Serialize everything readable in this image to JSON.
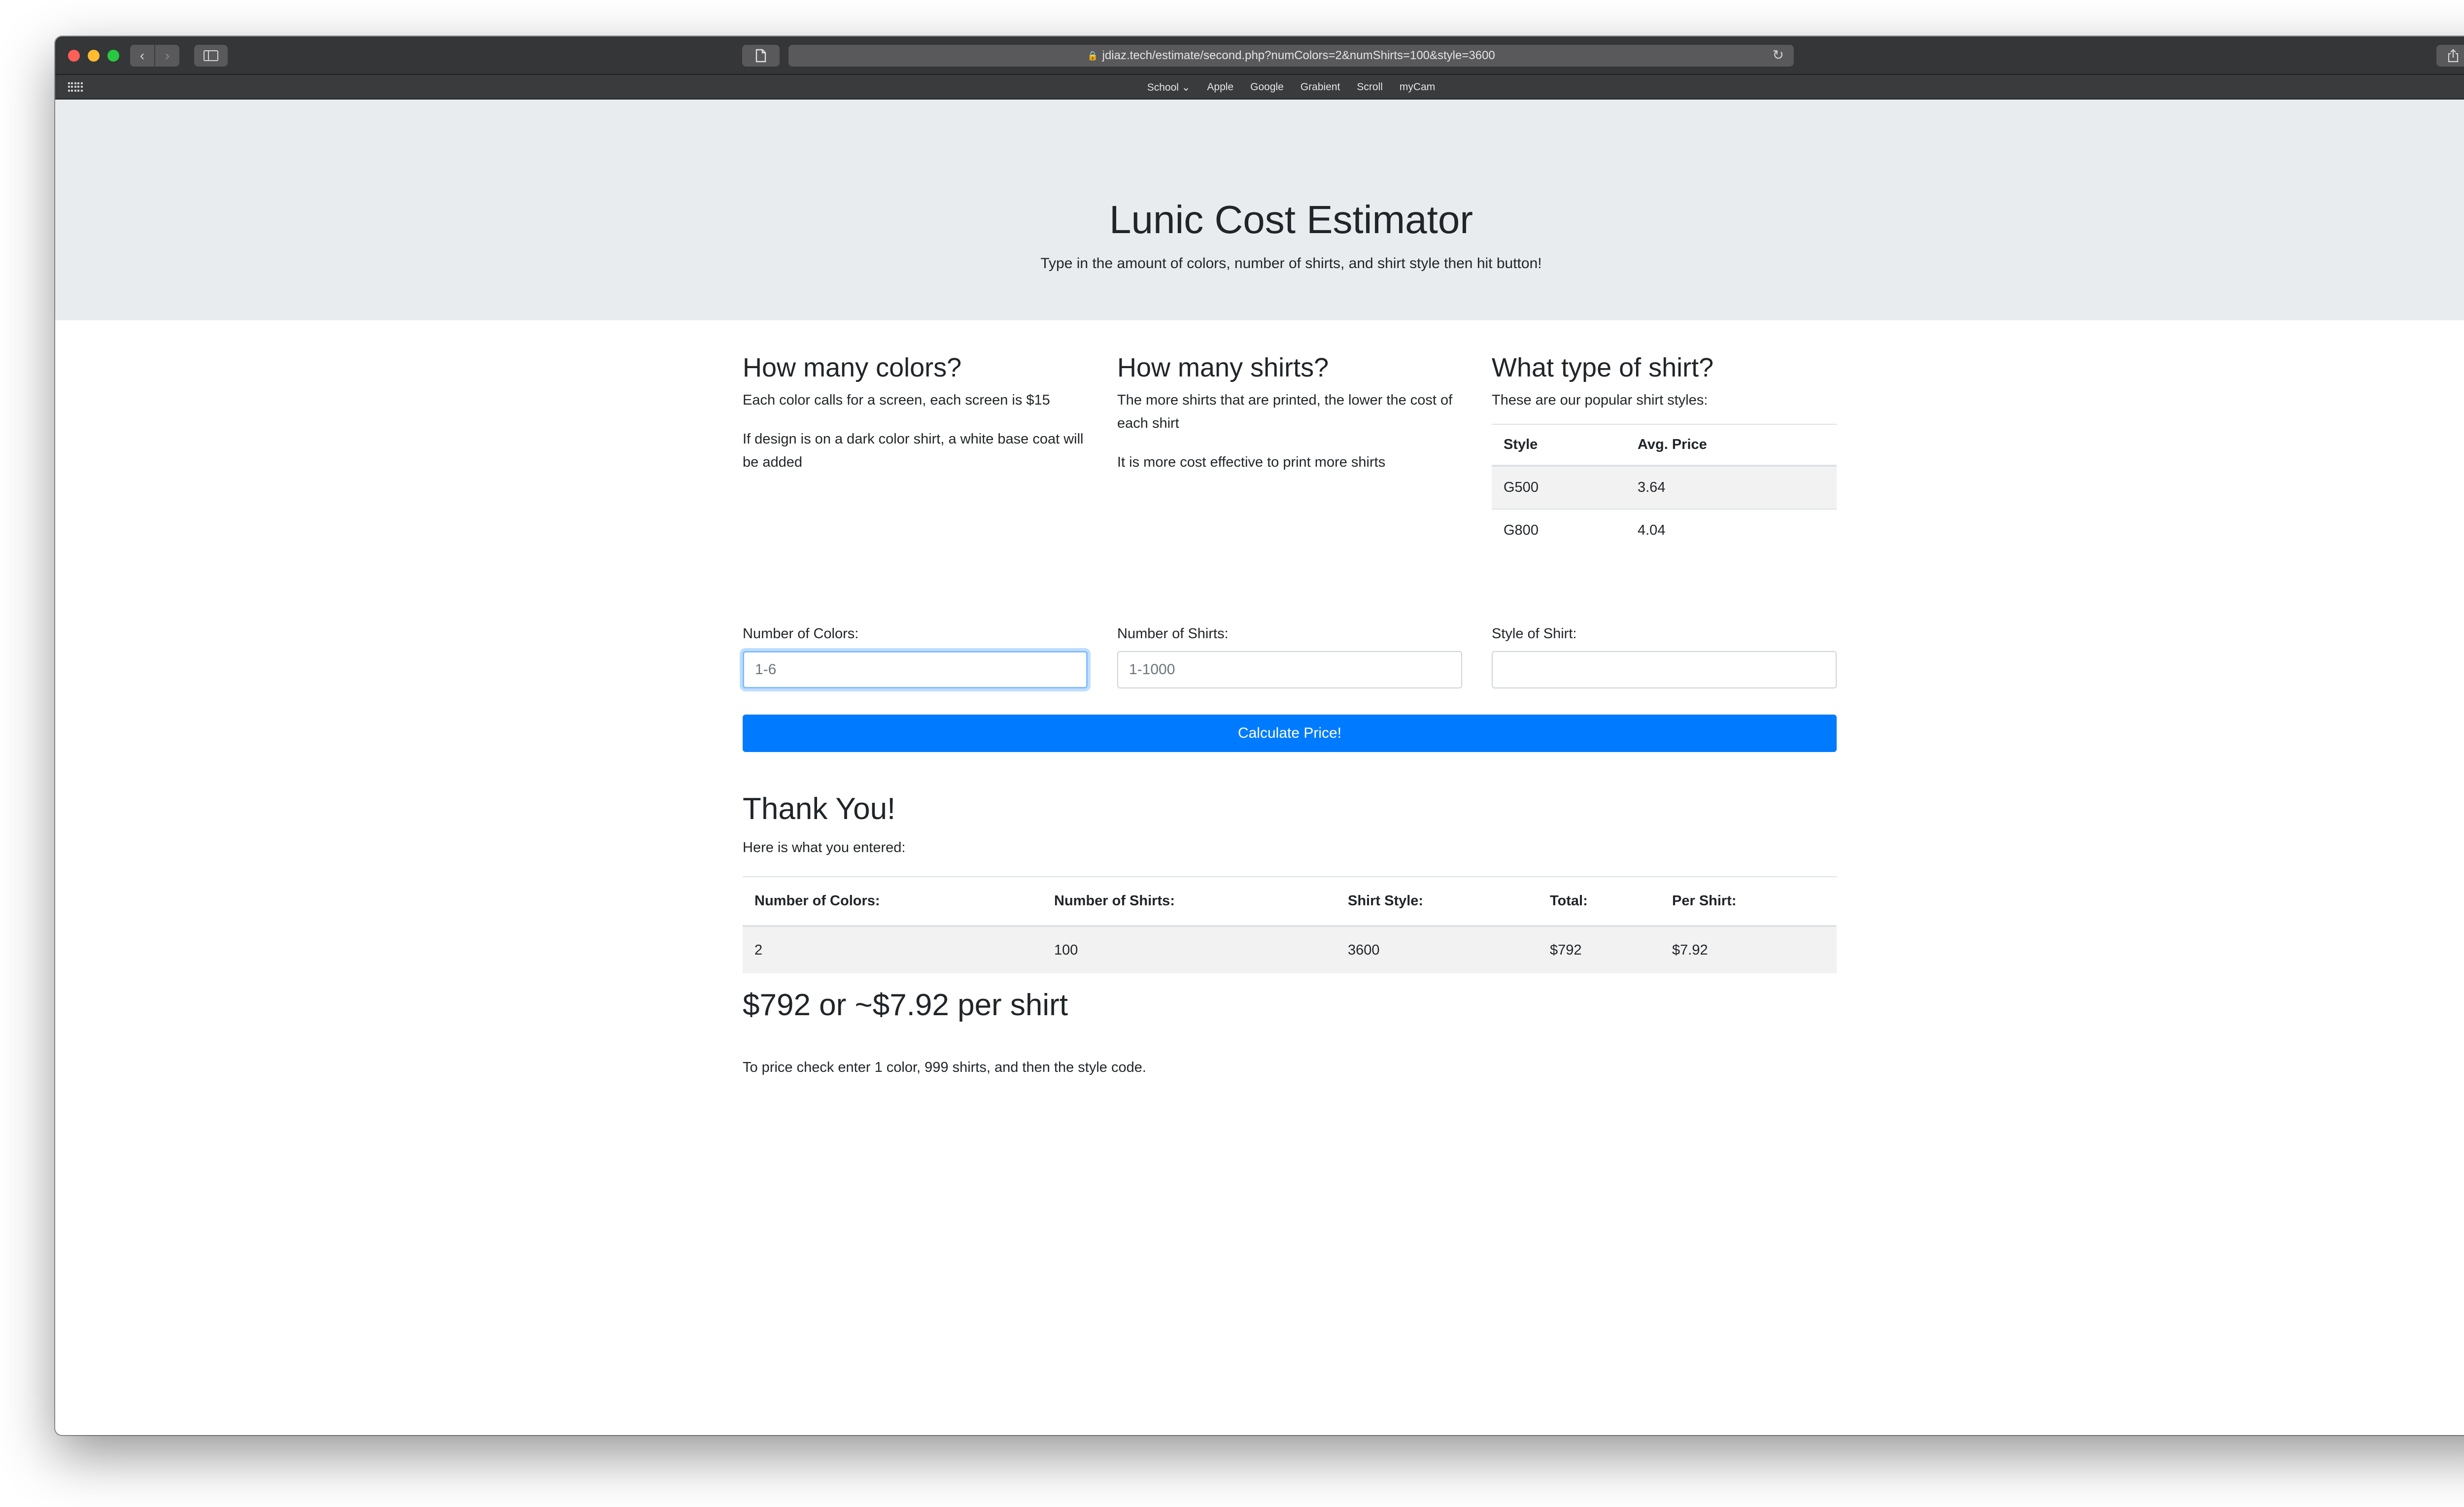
{
  "browser": {
    "url": "jdiaz.tech/estimate/second.php?numColors=2&numShirts=100&style=3600",
    "bookmarks": [
      "School",
      "Apple",
      "Google",
      "Grabient",
      "Scroll",
      "myCam"
    ]
  },
  "header": {
    "title": "Lunic Cost Estimator",
    "lead": "Type in the amount of colors, number of shirts, and shirt style then hit button!"
  },
  "colors_section": {
    "heading": "How many colors?",
    "p1": "Each color calls for a screen, each screen is $15",
    "p2": "If design is on a dark color shirt, a white base coat will be added"
  },
  "shirts_section": {
    "heading": "How many shirts?",
    "p1": "The more shirts that are printed, the lower the cost of each shirt",
    "p2": "It is more cost effective to print more shirts"
  },
  "styles_section": {
    "heading": "What type of shirt?",
    "p1": "These are our popular shirt styles:",
    "table": {
      "headers": [
        "Style",
        "Avg. Price"
      ],
      "rows": [
        [
          "G500",
          "3.64"
        ],
        [
          "G800",
          "4.04"
        ]
      ]
    }
  },
  "form": {
    "colors_label": "Number of Colors:",
    "colors_placeholder": "1-6",
    "shirts_label": "Number of Shirts:",
    "shirts_placeholder": "1-1000",
    "style_label": "Style of Shirt:",
    "style_placeholder": "",
    "submit_label": "Calculate Price!"
  },
  "result": {
    "title": "Thank You!",
    "subtitle": "Here is what you entered:",
    "headers": [
      "Number of Colors:",
      "Number of Shirts:",
      "Shirt Style:",
      "Total:",
      "Per Shirt:"
    ],
    "row": [
      "2",
      "100",
      "3600",
      "$792",
      "$7.92"
    ],
    "summary": "$792 or ~$7.92 per shirt",
    "note": "To price check enter 1 color, 999 shirts, and then the style code."
  },
  "theme": {
    "accent": "#007bff",
    "jumbotron_bg": "#e9ecef"
  }
}
